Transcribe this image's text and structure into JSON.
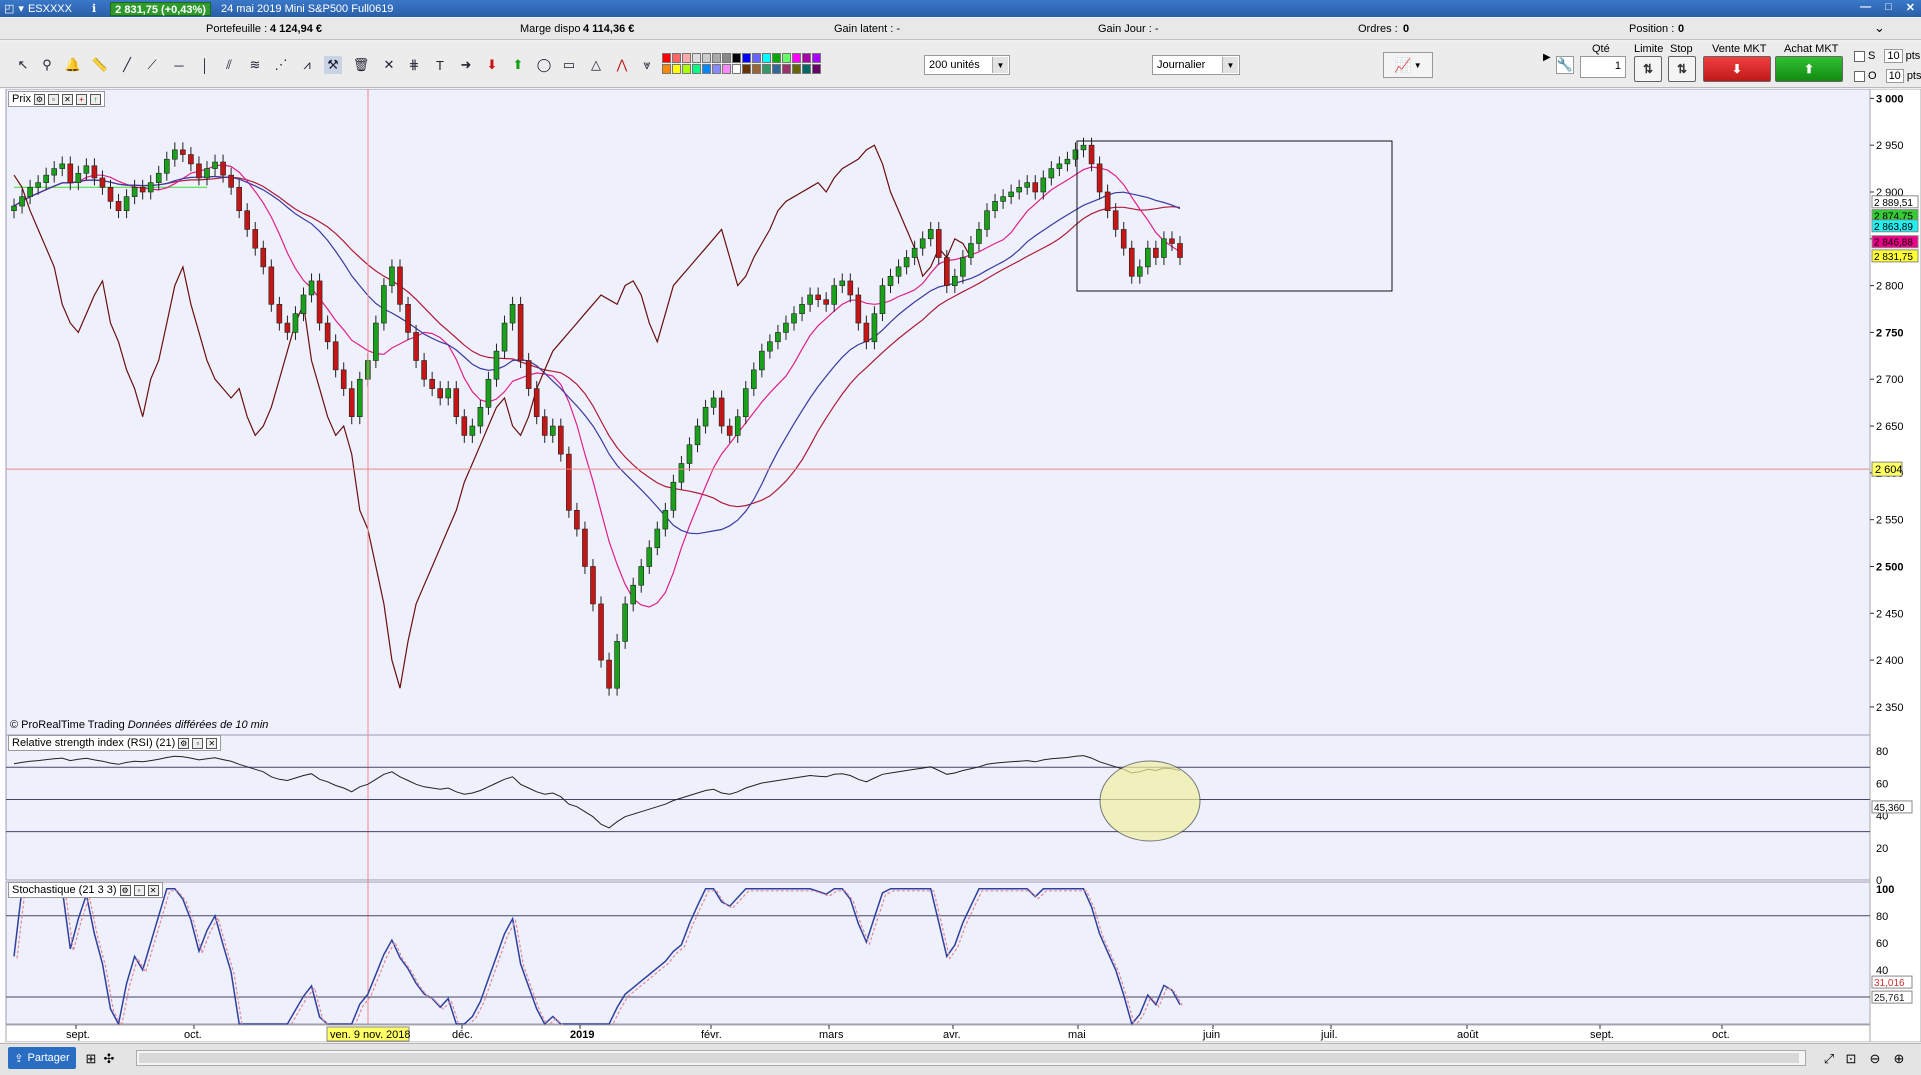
{
  "titlebar": {
    "instrument": "ESXXXX",
    "price": "2 831,75 (+0,43%)",
    "description": "24 mai 2019 Mini S&P500 Full0619",
    "minimize": "—",
    "maximize": "□",
    "close": "✕"
  },
  "infobar": {
    "portefeuille_label": "Portefeuille :",
    "portefeuille_value": "4 124,94 €",
    "marge_label": "Marge dispo",
    "marge_value": "4 114,36 €",
    "gain_latent": "Gain latent : -",
    "gain_jour": "Gain Jour : -",
    "ordres_label": "Ordres :",
    "ordres_value": "0",
    "position_label": "Position :",
    "position_value": "0"
  },
  "toolbar": {
    "units": "200 unités",
    "period": "Journalier",
    "qty_label": "Qté",
    "qty_value": "1",
    "limite_label": "Limite",
    "stop_label": "Stop",
    "sell_label": "Vente MKT",
    "buy_label": "Achat MKT",
    "s_label": "S",
    "o_label": "O",
    "s_value": "10",
    "o_value": "10",
    "pts": "pts",
    "colors": [
      "#ff0000",
      "#ff6666",
      "#ffaaaa",
      "#dddddd",
      "#cccccc",
      "#aaaaaa",
      "#888888",
      "#000000",
      "#0000ff",
      "#6666ff",
      "#00ffff",
      "#00aa00",
      "#66ff66",
      "#ff00ff",
      "#aa00aa",
      "#aa00ff",
      "#ff8800",
      "#ffff00",
      "#aaff00",
      "#00ff88",
      "#0088ff",
      "#8888ff",
      "#ff88ff",
      "#ffffff",
      "#663300",
      "#996633",
      "#339966",
      "#336699",
      "#993366",
      "#666600",
      "#006666",
      "#660066"
    ]
  },
  "panels": {
    "price_title": "Prix",
    "rsi_title": "Relative strength index (RSI) (21)",
    "stoch_title": "Stochastique (21 3 3)",
    "copyright": "© ProRealTime Trading",
    "delayed": "Données différées de 10 min"
  },
  "axis": {
    "price_ticks": [
      "3 000",
      "2 950",
      "2 900",
      "2 850",
      "2 800",
      "2 750",
      "2 700",
      "2 650",
      "2 600",
      "2 550",
      "2 500",
      "2 450",
      "2 400",
      "2 350"
    ],
    "rsi_ticks": [
      "80",
      "60",
      "40",
      "20",
      "0"
    ],
    "stoch_ticks": [
      "100",
      "80",
      "60",
      "40",
      "20"
    ],
    "date_ticks": [
      "sept.",
      "oct.",
      "déc.",
      "2019",
      "févr.",
      "mars",
      "avr.",
      "mai",
      "juin",
      "juil.",
      "août",
      "sept.",
      "oct."
    ],
    "cursor_date": "ven. 9 nov. 2018",
    "cursor_price": "2 604",
    "price_labels": [
      "2 889,51",
      "2 874,75",
      "2 863,89",
      "2 846,88",
      "2 831,75"
    ],
    "rsi_value": "45,360",
    "stoch_values": [
      "31,016",
      "25,761"
    ]
  },
  "chart_data": {
    "type": "line",
    "title": "",
    "xlabel": "",
    "ylabel": "",
    "ylim": [
      2320,
      3010
    ],
    "rsi_levels": [
      70,
      50,
      30
    ],
    "stoch_levels": [
      80,
      20
    ],
    "colors": {
      "up": "#1aa01a",
      "down": "#c41616",
      "cloud_top": "#28e6f0",
      "cloud_bottom": "#4de04d",
      "kijun": "#b01a3a",
      "tenkan": "#e0208a",
      "ma": "#3a3aa0",
      "chikou": "#6b0f0f"
    },
    "close": [
      2885,
      2895,
      2905,
      2910,
      2918,
      2925,
      2930,
      2910,
      2920,
      2928,
      2915,
      2905,
      2890,
      2880,
      2895,
      2905,
      2900,
      2910,
      2920,
      2935,
      2945,
      2940,
      2930,
      2915,
      2925,
      2932,
      2918,
      2905,
      2880,
      2860,
      2840,
      2820,
      2780,
      2760,
      2750,
      2770,
      2790,
      2805,
      2760,
      2740,
      2710,
      2690,
      2660,
      2700,
      2720,
      2760,
      2800,
      2820,
      2780,
      2750,
      2720,
      2700,
      2690,
      2680,
      2690,
      2660,
      2640,
      2650,
      2670,
      2700,
      2730,
      2760,
      2780,
      2720,
      2690,
      2660,
      2640,
      2650,
      2620,
      2560,
      2540,
      2500,
      2460,
      2400,
      2370,
      2420,
      2460,
      2480,
      2500,
      2520,
      2540,
      2560,
      2590,
      2610,
      2630,
      2650,
      2670,
      2680,
      2650,
      2640,
      2660,
      2690,
      2710,
      2730,
      2740,
      2750,
      2760,
      2770,
      2780,
      2790,
      2785,
      2780,
      2800,
      2805,
      2790,
      2760,
      2740,
      2770,
      2800,
      2810,
      2820,
      2830,
      2840,
      2850,
      2860,
      2830,
      2800,
      2810,
      2830,
      2845,
      2860,
      2880,
      2890,
      2895,
      2900,
      2905,
      2910,
      2900,
      2915,
      2925,
      2930,
      2935,
      2945,
      2950,
      2930,
      2900,
      2880,
      2860,
      2840,
      2810,
      2820,
      2840,
      2830,
      2850,
      2845,
      2830
    ]
  }
}
